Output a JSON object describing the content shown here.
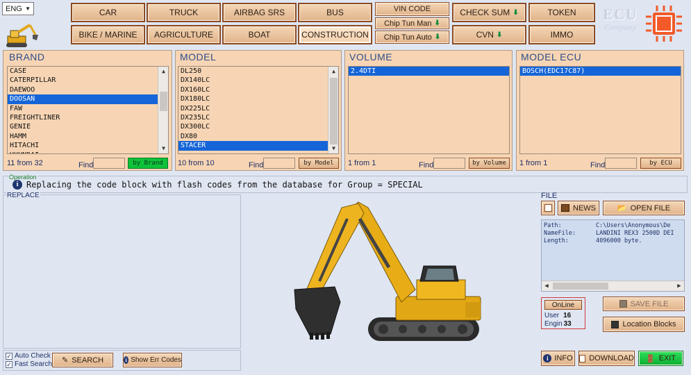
{
  "language": {
    "value": "ENG"
  },
  "categories": {
    "row1": [
      "CAR",
      "TRUCK",
      "AIRBAG SRS",
      "BUS"
    ],
    "row2": [
      "BIKE / MARINE",
      "AGRICULTURE",
      "BOAT",
      "CONSTRUCTION"
    ],
    "active": "CONSTRUCTION"
  },
  "tools": {
    "vin_code": "VIN CODE",
    "chip_tun_man": "Chip Tun Man",
    "chip_tun_auto": "Chip Tun Auto",
    "check_sum": "CHECK SUM",
    "cvn": "CVN",
    "token": "TOKEN",
    "immo": "IMMO"
  },
  "logo": {
    "line1": "ECU",
    "line2": "Company"
  },
  "brand": {
    "title": "BRAND",
    "items": [
      "CASE",
      "CATERPILLAR",
      "DAEWOO",
      "DOOSAN",
      "FAW",
      "FREIGHTLINER",
      "GENIE",
      "HAMM",
      "HITACHI",
      "HYUNDAI"
    ],
    "selected": "DOOSAN",
    "count": "11 from 32",
    "find_label": "Find",
    "by_button": "by Brand"
  },
  "model": {
    "title": "MODEL",
    "items": [
      "DL250",
      "DX140LC",
      "DX160LC",
      "DX180LC",
      "DX225LC",
      "DX235LC",
      "DX300LC",
      "DX80",
      "STACER"
    ],
    "selected": "STACER",
    "count": "10 from 10",
    "find_label": "Find",
    "by_button": "by Model"
  },
  "volume": {
    "title": "VOLUME",
    "items": [
      "2.4DTI"
    ],
    "selected": "2.4DTI",
    "count": "1 from 1",
    "find_label": "Find",
    "by_button": "by Volume"
  },
  "model_ecu": {
    "title": "MODEL ECU",
    "items": [
      "BOSCH(EDC17C87)"
    ],
    "selected": "BOSCH(EDC17C87)",
    "count": "1 from 1",
    "find_label": "Find",
    "by_button": "by ECU"
  },
  "operation": {
    "label": "Operation",
    "text": "Replacing the code block with flash codes from the database for Group = SPECIAL"
  },
  "replace": {
    "label": "REPLACE"
  },
  "options": {
    "auto_check": "Auto Check",
    "fast_search": "Fast Search",
    "search_button": "SEARCH",
    "show_err_codes": "Show Err Codes"
  },
  "file": {
    "label": "FILE",
    "news_button": "NEWS",
    "open_file_button": "OPEN FILE",
    "path_key": "Path:",
    "path_value": "C:\\Users\\Anonymous\\De",
    "name_key": "NameFile:",
    "name_value": "LANDINI REX3 2500D DEI",
    "length_key": "Length:",
    "length_value": "4096000 byte.",
    "save_file": "SAVE FILE",
    "location_blocks": "Location Blocks"
  },
  "online": {
    "button": "OnLine",
    "user_label": "User",
    "user_value": "16",
    "engin_label": "Engin",
    "engin_value": "33"
  },
  "footer": {
    "info": "INFO",
    "download": "DOWNLOAD",
    "exit": "EXIT"
  },
  "colors": {
    "panel_bg": "#f7d5b4",
    "selection": "#1565d8",
    "button_border": "#8b4a22",
    "title_blue": "#2c4d8b",
    "green": "#0fc23a"
  }
}
